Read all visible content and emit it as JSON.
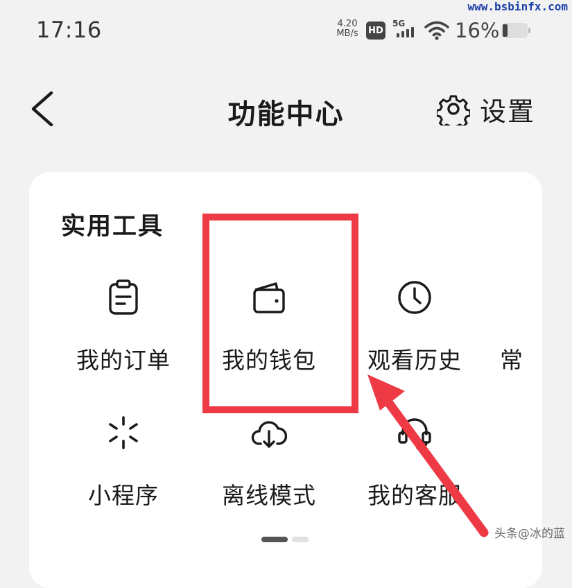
{
  "status_bar": {
    "time": "17:16",
    "net_speed_value": "4.20",
    "net_speed_unit": "MB/s",
    "hd_badge": "HD",
    "network_type": "5G",
    "battery_percent": "16%"
  },
  "watermark": {
    "url": "www.bsbinfx.com",
    "credit": "头条@冰的蓝"
  },
  "nav": {
    "title": "功能中心",
    "settings_label": "设置"
  },
  "section": {
    "title": "实用工具",
    "tools": [
      {
        "label": "我的订单",
        "icon": "order-clipboard-icon"
      },
      {
        "label": "我的钱包",
        "icon": "wallet-icon"
      },
      {
        "label": "观看历史",
        "icon": "clock-icon"
      },
      {
        "label": "常",
        "icon": ""
      },
      {
        "label": "小程序",
        "icon": "mini-program-icon"
      },
      {
        "label": "离线模式",
        "icon": "cloud-download-icon"
      },
      {
        "label": "我的客服",
        "icon": "headset-icon"
      }
    ]
  },
  "annotation": {
    "highlight_color": "#ee3a45",
    "highlighted_item": "我的钱包"
  }
}
